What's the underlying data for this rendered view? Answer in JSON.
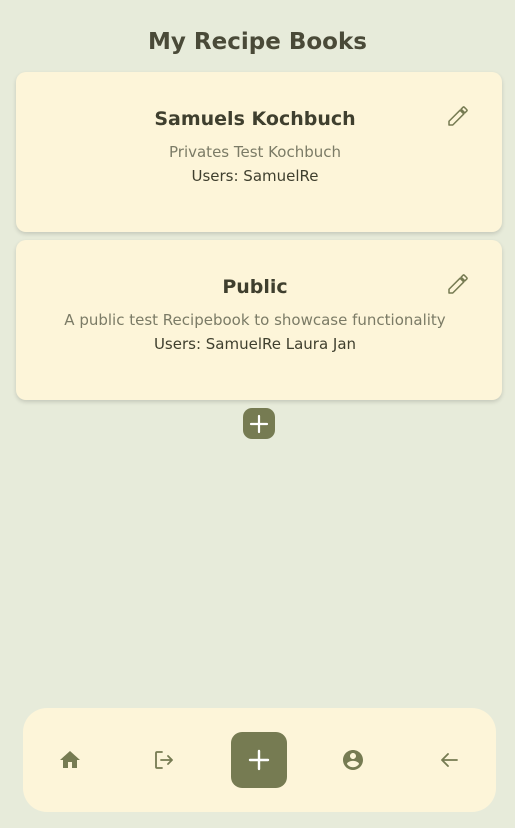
{
  "page": {
    "title": "My Recipe Books"
  },
  "books": [
    {
      "title": "Samuels Kochbuch",
      "description": "Privates Test Kochbuch",
      "users": "Users: SamuelRe",
      "edit_icon": "pencil-icon"
    },
    {
      "title": "Public",
      "description": "A public test Recipebook to showcase functionality",
      "users": "Users: SamuelRe Laura Jan",
      "edit_icon": "pencil-icon"
    }
  ],
  "add_book_icon": "plus-icon",
  "bottom_nav": {
    "items": [
      {
        "icon": "home-icon"
      },
      {
        "icon": "logout-icon"
      },
      {
        "icon": "plus-icon"
      },
      {
        "icon": "account-circle-icon"
      },
      {
        "icon": "arrow-left-icon"
      }
    ]
  },
  "colors": {
    "background": "#e7ebda",
    "card": "#fdf5d9",
    "accent": "#767b52",
    "title_text": "#4a4a38",
    "muted_text": "#7b7b66"
  }
}
